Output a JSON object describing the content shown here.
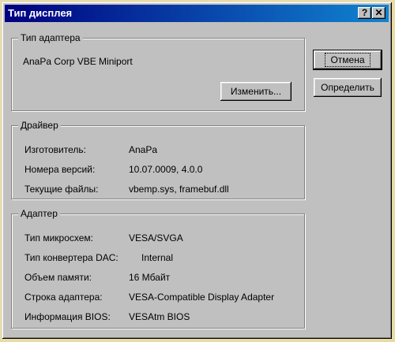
{
  "window": {
    "title": "Тип дисплея",
    "help_glyph": "?",
    "close_glyph": "✕"
  },
  "adapter_type": {
    "legend": "Тип адаптера",
    "name": "AnaPa Corp VBE Miniport",
    "change_button": "Изменить..."
  },
  "buttons": {
    "cancel": "Отмена",
    "detect": "Определить"
  },
  "driver": {
    "legend": "Драйвер",
    "rows": [
      {
        "label": "Изготовитель:",
        "value": "AnaPa"
      },
      {
        "label": "Номера версий:",
        "value": "10.07.0009, 4.0.0"
      },
      {
        "label": "Текущие файлы:",
        "value": "vbemp.sys, framebuf.dll"
      }
    ]
  },
  "adapter": {
    "legend": "Адаптер",
    "rows": [
      {
        "label": "Тип микросхем:",
        "value": "VESA/SVGA"
      },
      {
        "label": "Тип конвертера DAC:",
        "value": "Internal"
      },
      {
        "label": "Объем памяти:",
        "value": "16 Мбайт"
      },
      {
        "label": "Строка адаптера:",
        "value": "VESA-Compatible Display Adapter"
      },
      {
        "label": "Информация BIOS:",
        "value": "VESAtm BIOS"
      }
    ]
  }
}
